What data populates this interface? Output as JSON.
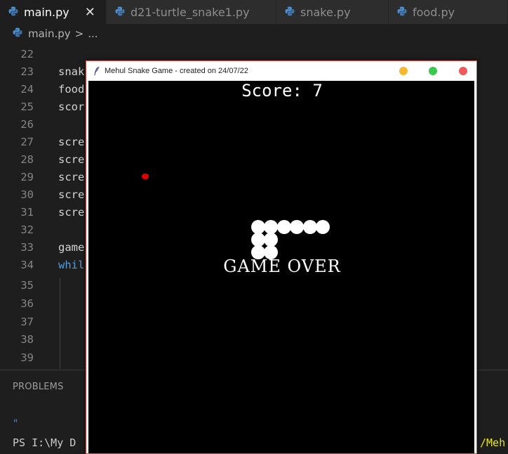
{
  "tabs": [
    {
      "label": "main.py",
      "active": true,
      "close": "✕"
    },
    {
      "label": "d21-turtle_snake1.py"
    },
    {
      "label": "snake.py"
    },
    {
      "label": "food.py"
    }
  ],
  "breadcrumb": {
    "file": "main.py",
    "separator": ">",
    "rest": "..."
  },
  "editor": {
    "lines": [
      {
        "num": "22",
        "code": ""
      },
      {
        "num": "23",
        "code": "snak"
      },
      {
        "num": "24",
        "code": "food"
      },
      {
        "num": "25",
        "code": "scor"
      },
      {
        "num": "26",
        "code": ""
      },
      {
        "num": "27",
        "code": "scre"
      },
      {
        "num": "28",
        "code": "scre"
      },
      {
        "num": "29",
        "code": "scre"
      },
      {
        "num": "30",
        "code": "scre"
      },
      {
        "num": "31",
        "code": "scre"
      },
      {
        "num": "32",
        "code": ""
      },
      {
        "num": "33",
        "code": "game"
      },
      {
        "num": "34",
        "code": "whil"
      },
      {
        "num": "35",
        "code": ""
      },
      {
        "num": "36",
        "code": ""
      },
      {
        "num": "37",
        "code": ""
      },
      {
        "num": "38",
        "code": ""
      },
      {
        "num": "39",
        "code": ""
      }
    ]
  },
  "panel": {
    "tab": "PROBLEMS",
    "terminal_quote": "\"",
    "terminal_prompt": "PS I:\\My D",
    "terminal_path_tail": "/Meh"
  },
  "game_window": {
    "title": "Mehul Snake Game - created on 24/07/22",
    "score_text": "Score: 7",
    "game_over_text": "GAME OVER",
    "background": "#000000",
    "snake_color": "#ffffff",
    "food_color": "#e00000"
  },
  "colors": {
    "editor_bg": "#1e1e1e",
    "tab_bg": "#2d2d2d",
    "keyword": "#569cd6",
    "window_border": "#d9534f"
  }
}
